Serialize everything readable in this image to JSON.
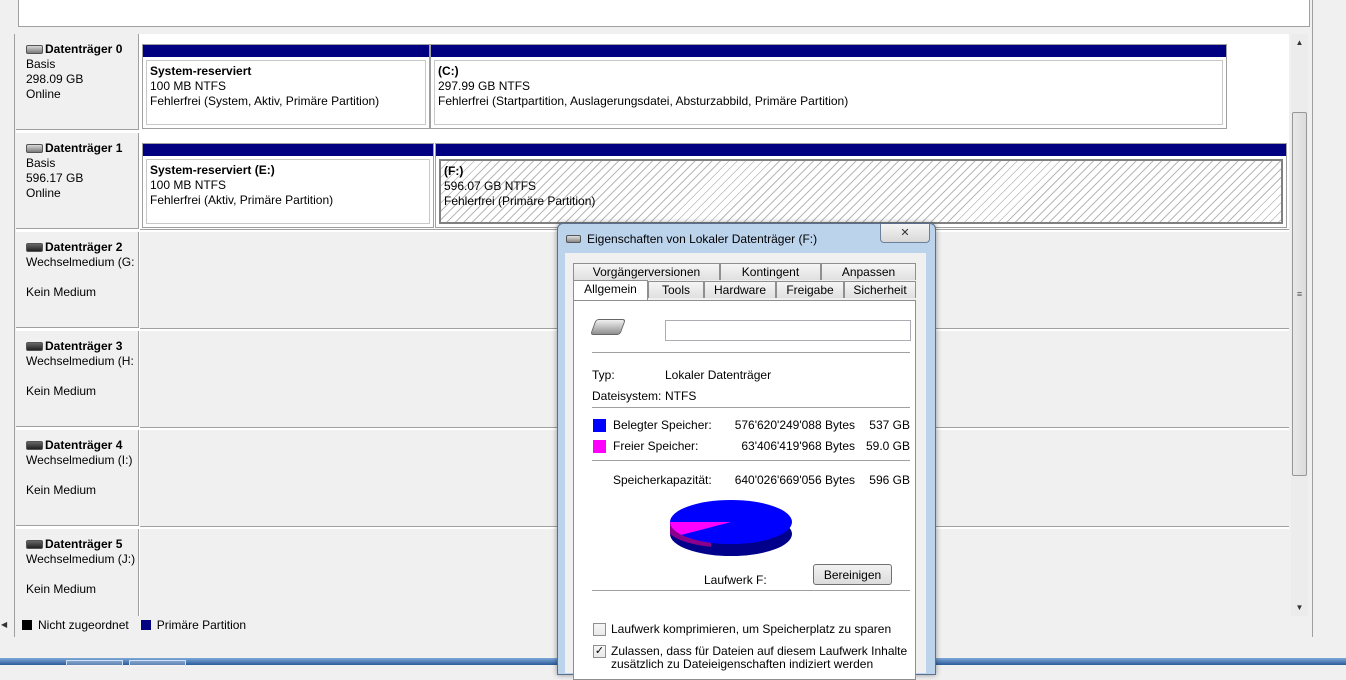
{
  "disks": [
    {
      "name": "Datenträger 0",
      "type": "Basis",
      "size": "298.09 GB",
      "status": "Online",
      "partitions": [
        {
          "title": "System-reserviert",
          "size": "100 MB NTFS",
          "status": "Fehlerfrei (System, Aktiv, Primäre Partition)"
        },
        {
          "title": "(C:)",
          "size": "297.99 GB NTFS",
          "status": "Fehlerfrei (Startpartition, Auslagerungsdatei, Absturzabbild, Primäre Partition)"
        }
      ]
    },
    {
      "name": "Datenträger 1",
      "type": "Basis",
      "size": "596.17 GB",
      "status": "Online",
      "partitions": [
        {
          "title": "System-reserviert  (E:)",
          "size": "100 MB NTFS",
          "status": "Fehlerfrei (Aktiv, Primäre Partition)"
        },
        {
          "title": "(F:)",
          "size": "596.07 GB NTFS",
          "status": "Fehlerfrei (Primäre Partition)"
        }
      ]
    },
    {
      "name": "Datenträger 2",
      "type": "Wechselmedium (G:",
      "status": "Kein Medium"
    },
    {
      "name": "Datenträger 3",
      "type": "Wechselmedium (H:",
      "status": "Kein Medium"
    },
    {
      "name": "Datenträger 4",
      "type": "Wechselmedium (I:)",
      "status": "Kein Medium"
    },
    {
      "name": "Datenträger 5",
      "type": "Wechselmedium (J:)",
      "status": "Kein Medium"
    }
  ],
  "legend": [
    {
      "label": "Nicht zugeordnet",
      "color": "#000000"
    },
    {
      "label": "Primäre Partition",
      "color": "#000080"
    }
  ],
  "dialog": {
    "title": "Eigenschaften von Lokaler Datenträger (F:)",
    "close_label": "✕",
    "tabs_row1": [
      "Vorgängerversionen",
      "Kontingent",
      "Anpassen"
    ],
    "tabs_row2": [
      "Allgemein",
      "Tools",
      "Hardware",
      "Freigabe",
      "Sicherheit"
    ],
    "active_tab": "Allgemein",
    "name_value": "",
    "type_label": "Typ:",
    "type_value": "Lokaler Datenträger",
    "fs_label": "Dateisystem:",
    "fs_value": "NTFS",
    "used": {
      "label": "Belegter Speicher:",
      "bytes": "576'620'249'088 Bytes",
      "gb": "537 GB",
      "color": "#0000ff"
    },
    "free": {
      "label": "Freier Speicher:",
      "bytes": "63'406'419'968 Bytes",
      "gb": "59.0 GB",
      "color": "#ff00ff"
    },
    "capacity": {
      "label": "Speicherkapazität:",
      "bytes": "640'026'669'056 Bytes",
      "gb": "596 GB"
    },
    "used_fraction": 0.901,
    "drive_label": "Laufwerk F:",
    "cleanup_label": "Bereinigen",
    "compress_label": "Laufwerk komprimieren, um Speicherplatz zu sparen",
    "compress_checked": false,
    "index_label_1": "Zulassen, dass für Dateien auf diesem Laufwerk Inhalte",
    "index_label_2": "zusätzlich zu Dateieigenschaften indiziert werden",
    "index_checked": true
  }
}
